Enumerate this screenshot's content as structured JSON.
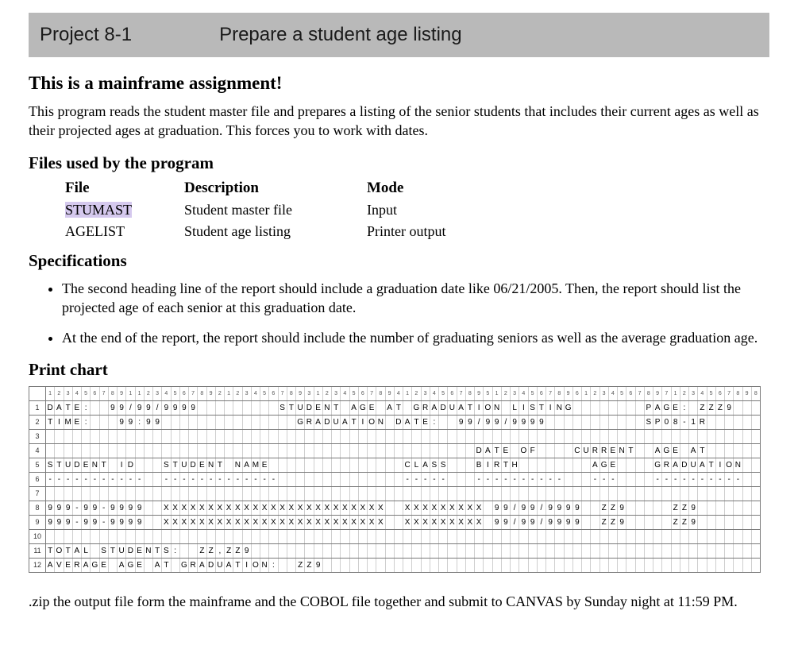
{
  "banner": {
    "project": "Project 8-1",
    "title": "Prepare a student age listing"
  },
  "headings": {
    "main": "This is a mainframe assignment!",
    "files": "Files used by the program",
    "specs": "Specifications",
    "chart": "Print chart"
  },
  "intro": "This program reads the student master file and prepares a listing of the senior students that includes their current ages as well as their projected ages at graduation. This forces you to work with dates.",
  "filesHeader": {
    "c1": "File",
    "c2": "Description",
    "c3": "Mode"
  },
  "files": [
    {
      "name": "STUMAST",
      "desc": "Student master file",
      "mode": "Input",
      "hl": true
    },
    {
      "name": "AGELIST",
      "desc": "Student age listing",
      "mode": "Printer output",
      "hl": false
    }
  ],
  "specs": [
    "The second heading line of the report should include a graduation date like 06/21/2005. Then, the report should list the projected age of each senior at this graduation date.",
    "At the end of the report, the report should include the number of graduating seniors as well as the average graduation age."
  ],
  "footer": ".zip the output file form the mainframe and the COBOL file together and submit to CANVAS by Sunday night at 11:59 PM.",
  "printChart": {
    "cols": 80,
    "lines": [
      "DATE:  99/99/9999         STUDENT AGE AT GRADUATION LISTING        PAGE: ZZZ9",
      "TIME:   99:99               GRADUATION DATE:  99/99/9999           SP08-1R   ",
      "                                                                                ",
      "                                                DATE OF    CURRENT  AGE AT     ",
      "STUDENT ID   STUDENT NAME               CLASS   BIRTH        AGE    GRADUATION ",
      "-----------  -------------              -----   ----------   ---    ---------- ",
      "                                                                                ",
      "999-99-9999  XXXXXXXXXXXXXXXXXXXXXXXXX  XXXXXXXXX 99/99/9999  ZZ9     ZZ9       ",
      "999-99-9999  XXXXXXXXXXXXXXXXXXXXXXXXX  XXXXXXXXX 99/99/9999  ZZ9     ZZ9       ",
      "                                                                                ",
      "TOTAL STUDENTS:  ZZ,ZZ9                                                         ",
      "AVERAGE AGE AT GRADUATION:  ZZ9                                                 "
    ]
  }
}
